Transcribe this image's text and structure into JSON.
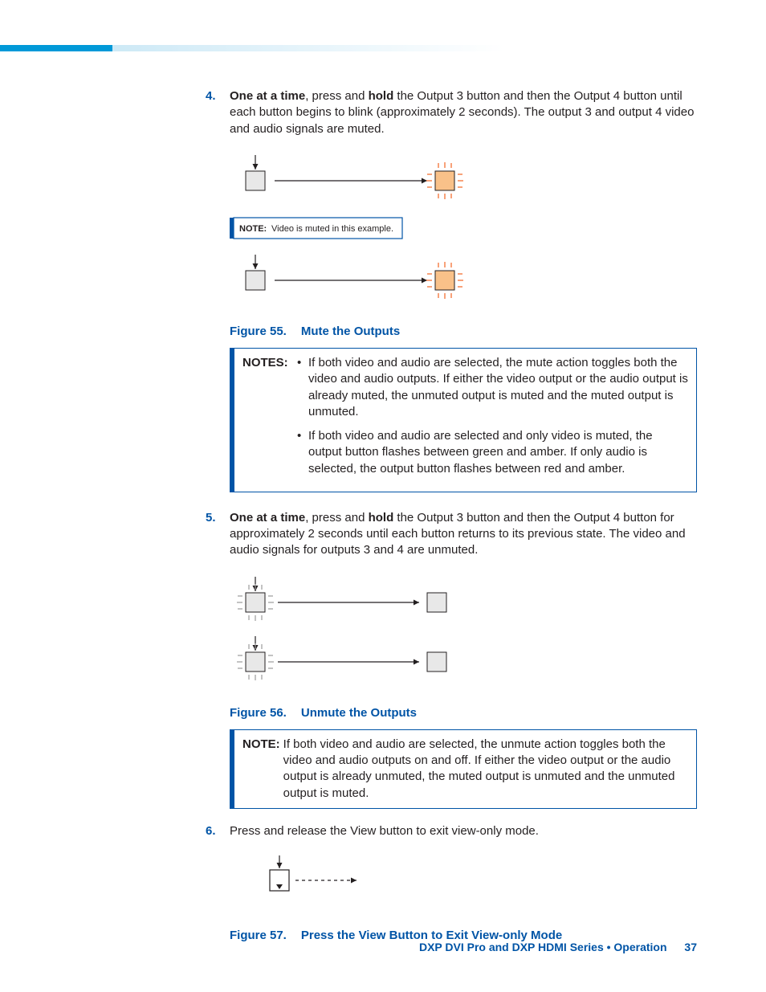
{
  "steps": {
    "s4": {
      "num": "4.",
      "prefix": "One at a time",
      "mid": ", press and ",
      "hold": "hold",
      "rest": " the Output 3 button and then the Output 4 button until each button begins to blink (approximately 2 seconds). The output 3 and output 4 video and audio signals are muted."
    },
    "s5": {
      "num": "5.",
      "prefix": "One at a time",
      "mid": ", press and ",
      "hold": "hold",
      "rest": " the Output 3 button and then the Output 4 button for approximately 2 seconds until each button returns to its previous state. The video and audio signals for outputs 3 and 4 are unmuted."
    },
    "s6": {
      "num": "6.",
      "text": "Press and release the View button to exit view-only mode."
    }
  },
  "figures": {
    "f55": {
      "num": "Figure 55.",
      "title": "Mute the Outputs"
    },
    "f56": {
      "num": "Figure 56.",
      "title": "Unmute the Outputs"
    },
    "f57": {
      "num": "Figure 57.",
      "title": "Press the View Button to Exit View-only Mode"
    }
  },
  "mininote": {
    "label": "NOTE:",
    "text": "Video is muted in this example."
  },
  "notes_multi": {
    "label": "NOTES:",
    "items": [
      "If both video and audio are selected, the mute action toggles both the video and audio outputs. If either the video output or the audio output is already muted, the unmuted output is muted and the muted output is unmuted.",
      "If both video and audio are selected and only video is muted, the output button flashes between green and amber. If only audio is selected, the output button flashes between red and amber."
    ]
  },
  "note_single": {
    "label": "NOTE:",
    "text": "If both video and audio are selected, the unmute action toggles both the video and audio outputs on and off. If either the video output or the audio output is already unmuted, the muted output is unmuted and the unmuted output is muted."
  },
  "footer": {
    "title": "DXP DVI Pro and DXP HDMI Series • Operation",
    "page": "37"
  }
}
